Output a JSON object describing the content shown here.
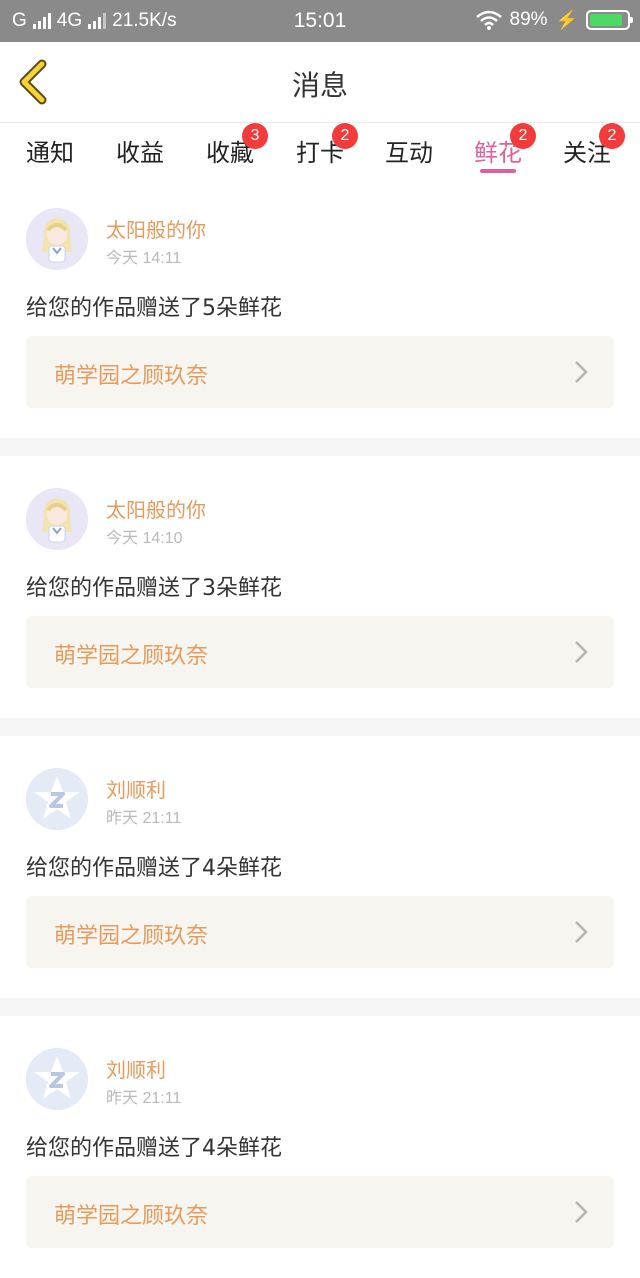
{
  "status_bar": {
    "carrier1": "G",
    "network": "4G",
    "speed": "21.5K/s",
    "time": "15:01",
    "battery": "89%",
    "battery_level": 0.89
  },
  "header": {
    "title": "消息"
  },
  "tabs": [
    {
      "label": "通知",
      "badge": ""
    },
    {
      "label": "收益",
      "badge": ""
    },
    {
      "label": "收藏",
      "badge": "3"
    },
    {
      "label": "打卡",
      "badge": "2"
    },
    {
      "label": "互动",
      "badge": ""
    },
    {
      "label": "鲜花",
      "badge": "2",
      "active": true
    },
    {
      "label": "关注",
      "badge": "2"
    }
  ],
  "colors": {
    "accent": "#e0609a",
    "name": "#e89a5c",
    "badge": "#f23c3c"
  },
  "messages": [
    {
      "name": "太阳般的你",
      "time": "今天 14:11",
      "text": "给您的作品赠送了5朵鲜花",
      "work": "萌学园之顾玖奈",
      "avatar": "anime-girl-avatar"
    },
    {
      "name": "太阳般的你",
      "time": "今天 14:10",
      "text": "给您的作品赠送了3朵鲜花",
      "work": "萌学园之顾玖奈",
      "avatar": "anime-girl-avatar"
    },
    {
      "name": "刘顺利",
      "time": "昨天 21:11",
      "text": "给您的作品赠送了4朵鲜花",
      "work": "萌学园之顾玖奈",
      "avatar": "default-star-avatar"
    },
    {
      "name": "刘顺利",
      "time": "昨天 21:11",
      "text": "给您的作品赠送了4朵鲜花",
      "work": "萌学园之顾玖奈",
      "avatar": "default-star-avatar"
    }
  ]
}
